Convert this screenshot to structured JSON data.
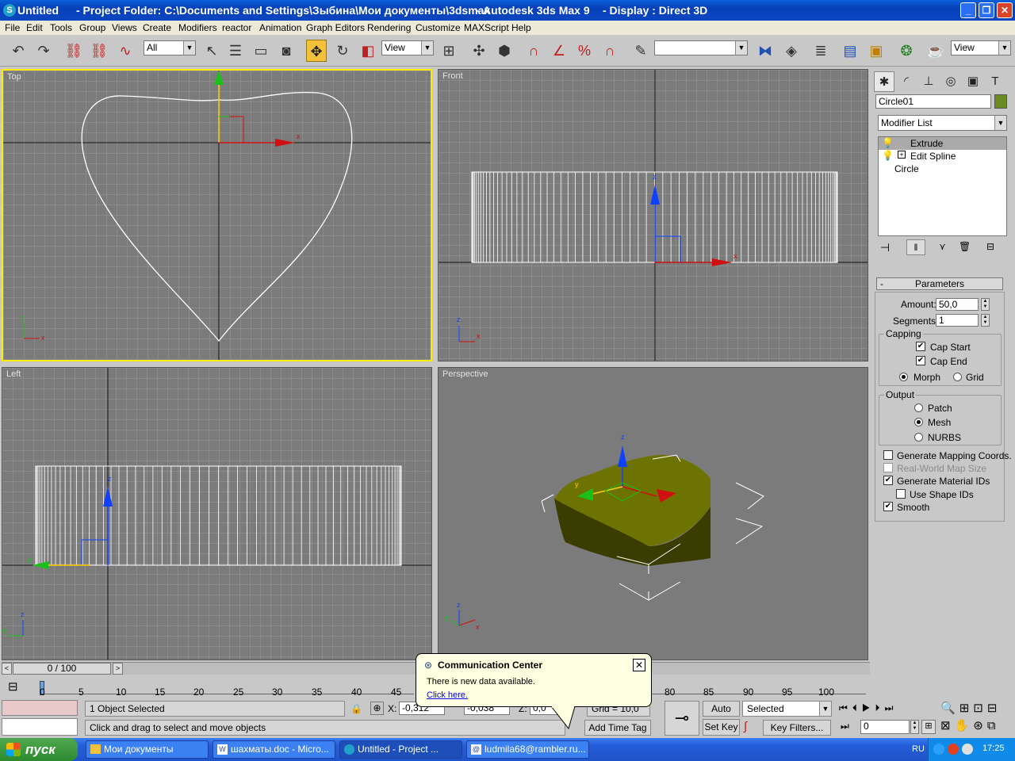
{
  "window": {
    "app_title": "Untitled",
    "project": "- Project Folder: C:\\Documents and Settings\\Зыбина\\Мои документы\\3dsmax",
    "app_name": "- Autodesk 3ds Max 9",
    "display": "- Display : Direct 3D"
  },
  "menu": [
    "File",
    "Edit",
    "Tools",
    "Group",
    "Views",
    "Create",
    "Modifiers",
    "reactor",
    "Animation",
    "Graph Editors",
    "Rendering",
    "Customize",
    "MAXScript",
    "Help"
  ],
  "toolbar": {
    "selection_filter": "All",
    "ref_coord": "View",
    "named_selection": "",
    "view_right": "View"
  },
  "viewports": {
    "top": "Top",
    "front": "Front",
    "left": "Left",
    "perspective": "Perspective"
  },
  "axis": {
    "x": "x",
    "y": "y",
    "z": "z"
  },
  "panel": {
    "object_name": "Circle01",
    "object_color": "#6b8a1f",
    "modifier_list": "Modifier List",
    "stack": [
      "Extrude",
      "Edit Spline",
      "Circle"
    ],
    "rollout": "Parameters",
    "rollout_sign": "-",
    "amount_label": "Amount:",
    "amount": "50,0",
    "segments_label": "Segments:",
    "segments": "1",
    "capping": "Capping",
    "cap_start": "Cap Start",
    "cap_end": "Cap End",
    "morph": "Morph",
    "grid": "Grid",
    "output": "Output",
    "patch": "Patch",
    "mesh": "Mesh",
    "nurbs": "NURBS",
    "gen_mapping": "Generate Mapping Coords.",
    "real_world": "Real-World Map Size",
    "gen_matids": "Generate Material IDs",
    "use_shape_ids": "Use Shape IDs",
    "smooth": "Smooth"
  },
  "timeline": {
    "slider": "0 / 100",
    "ticks": [
      "0",
      "5",
      "10",
      "15",
      "20",
      "25",
      "30",
      "35",
      "40",
      "45",
      "80",
      "85",
      "90",
      "95",
      "100"
    ]
  },
  "status": {
    "selected": "1 Object Selected",
    "prompt": "Click and drag to select and move objects",
    "x_label": "X:",
    "x": "-0,312",
    "y": "-0,038",
    "z_label": "Z:",
    "z": "0,0",
    "grid": "Grid = 10,0",
    "add_time_tag": "Add Time Tag",
    "auto_key": "Auto Key",
    "set_key": "Set Key",
    "key_mode": "Selected",
    "key_filters": "Key Filters...",
    "frame": "0"
  },
  "popup": {
    "title": "Communication Center",
    "message": "There is new data available.",
    "link": "Click here."
  },
  "taskbar": {
    "start": "пуск",
    "tasks": [
      "Мои документы",
      "шахматы.doc - Micro...",
      "Untitled      - Project ...",
      "ludmila68@rambler.ru..."
    ],
    "lang": "RU",
    "time": "17:25"
  }
}
